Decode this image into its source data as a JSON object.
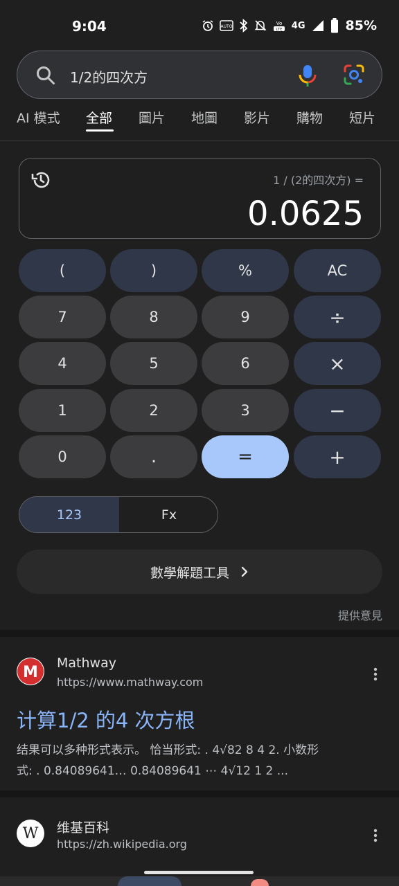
{
  "status_bar": {
    "time": "9:04",
    "network": "4G",
    "battery": "85%"
  },
  "search": {
    "query": "1/2的四次方"
  },
  "tabs": [
    "AI 模式",
    "全部",
    "圖片",
    "地圖",
    "影片",
    "購物",
    "短片"
  ],
  "calculator": {
    "expression": "1 / (2的四次方) =",
    "result": "0.0625",
    "keys": [
      [
        "(",
        ")",
        "%",
        "AC"
      ],
      [
        "7",
        "8",
        "9",
        "÷"
      ],
      [
        "4",
        "5",
        "6",
        "×"
      ],
      [
        "1",
        "2",
        "3",
        "−"
      ],
      [
        "0",
        ".",
        "=",
        "+"
      ]
    ],
    "modes": [
      "123",
      "Fx"
    ],
    "math_tools_label": "數學解題工具",
    "feedback": "提供意見"
  },
  "results": [
    {
      "site": "Mathway",
      "url": "https://www.mathway.com",
      "title": "计算1/2 的4 次方根",
      "snippet_line1": "结果可以多种形式表示。 恰当形式: . 4√82 8 4 2. 小数形",
      "snippet_line2": "式: . 0.84089641… 0.84089641 ⋯ 4√12 1 2 ..."
    },
    {
      "site": "维基百科",
      "url": "https://zh.wikipedia.org",
      "favicon_letter": "W"
    }
  ],
  "colors": {
    "accent": "#a8c7fa",
    "link": "#8ab4f8",
    "background": "#1f1f1f"
  }
}
